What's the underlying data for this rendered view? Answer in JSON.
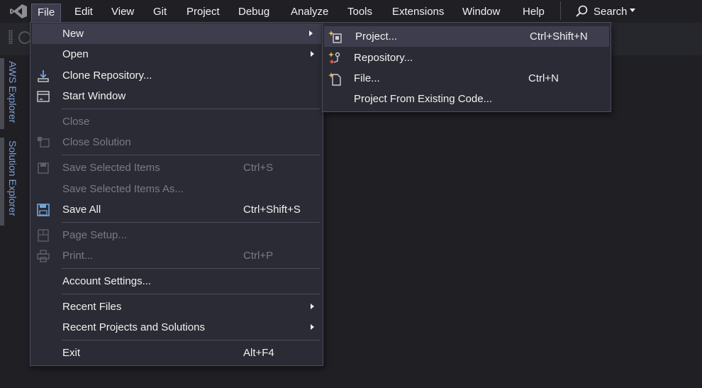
{
  "menubar": {
    "items": [
      "File",
      "Edit",
      "View",
      "Git",
      "Project",
      "Debug",
      "Analyze",
      "Tools",
      "Extensions",
      "Window",
      "Help"
    ],
    "search_label": "Search"
  },
  "side_rail": {
    "tabs": [
      "AWS Explorer",
      "Solution Explorer"
    ]
  },
  "file_menu": {
    "new": {
      "label": "New"
    },
    "open": {
      "label": "Open"
    },
    "clone_repository": {
      "label": "Clone Repository..."
    },
    "start_window": {
      "label": "Start Window"
    },
    "close": {
      "label": "Close"
    },
    "close_solution": {
      "label": "Close Solution"
    },
    "save_selected_items": {
      "label": "Save Selected Items",
      "shortcut": "Ctrl+S"
    },
    "save_selected_items_as": {
      "label": "Save Selected Items As..."
    },
    "save_all": {
      "label": "Save All",
      "shortcut": "Ctrl+Shift+S"
    },
    "page_setup": {
      "label": "Page Setup..."
    },
    "print": {
      "label": "Print...",
      "shortcut": "Ctrl+P"
    },
    "account_settings": {
      "label": "Account Settings..."
    },
    "recent_files": {
      "label": "Recent Files"
    },
    "recent_projects": {
      "label": "Recent Projects and Solutions"
    },
    "exit": {
      "label": "Exit",
      "shortcut": "Alt+F4"
    }
  },
  "new_submenu": {
    "project": {
      "label": "Project...",
      "shortcut": "Ctrl+Shift+N"
    },
    "repository": {
      "label": "Repository..."
    },
    "file": {
      "label": "File...",
      "shortcut": "Ctrl+N"
    },
    "project_from_existing": {
      "label": "Project From Existing Code..."
    }
  },
  "colors": {
    "background": "#1f1f24",
    "menu_background": "#2b2b35",
    "hover": "#3d3d4d",
    "disabled_text": "#7a7a85",
    "rail_text": "#7fa0d8",
    "vs_logo": "#8d8d95"
  },
  "icons": {
    "logo": "visual-studio-logo",
    "search": "search-icon"
  }
}
